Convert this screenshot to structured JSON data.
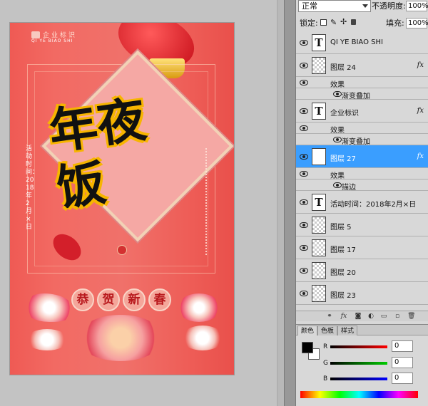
{
  "options": {
    "blend_mode": "正常",
    "opacity_label": "不透明度:",
    "opacity_value": "100%",
    "lock_label": "锁定:",
    "fill_label": "填充:",
    "fill_value": "100%"
  },
  "poster": {
    "logo_cn": "企业标识",
    "logo_en": "QI YE BIAO SHI",
    "main_title": "年夜饭",
    "date_text": "活动时间：2018年2月×日",
    "greeting": [
      "恭",
      "贺",
      "新",
      "春"
    ],
    "accent": "#ee5d57"
  },
  "layers": [
    {
      "name": "QI YE BIAO SHI",
      "type": "text",
      "fx": false
    },
    {
      "name": "图层 24",
      "type": "pixel",
      "fx": true
    },
    {
      "name": "效果",
      "type": "effect-group"
    },
    {
      "name": "渐变叠加",
      "type": "effect"
    },
    {
      "name": "企业标识",
      "type": "text",
      "fx": true
    },
    {
      "name": "效果",
      "type": "effect-group"
    },
    {
      "name": "渐变叠加",
      "type": "effect"
    },
    {
      "name": "图层 27",
      "type": "pixel",
      "fx": true,
      "selected": true
    },
    {
      "name": "效果",
      "type": "effect-group"
    },
    {
      "name": "描边",
      "type": "effect"
    },
    {
      "name": "活动时间：2018年2月×日",
      "type": "text",
      "fx": false
    },
    {
      "name": "图层 5",
      "type": "pixel",
      "fx": false
    },
    {
      "name": "图层 17",
      "type": "pixel",
      "fx": false
    },
    {
      "name": "图层 20",
      "type": "pixel",
      "fx": false
    },
    {
      "name": "图层 23",
      "type": "pixel",
      "fx": false
    }
  ],
  "fx_label": "fx",
  "color_panel": {
    "tabs": [
      "颜色",
      "色板",
      "样式"
    ],
    "active_tab": "颜色",
    "channels": [
      {
        "label": "R",
        "value": "0",
        "color": "#ff0000"
      },
      {
        "label": "G",
        "value": "0",
        "color": "#00aa00"
      },
      {
        "label": "B",
        "value": "0",
        "color": "#0000ff"
      }
    ],
    "foreground": "#000000",
    "background": "#ffffff"
  },
  "selection_color": "#3a9eff"
}
